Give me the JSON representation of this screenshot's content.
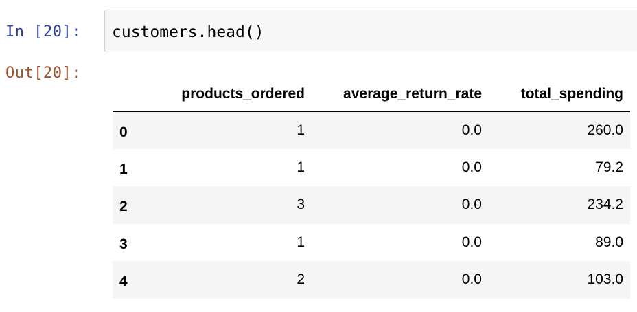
{
  "cell": {
    "in_prompt": "In [20]:",
    "code": "customers.head()",
    "out_prompt": "Out[20]:"
  },
  "dataframe": {
    "columns": [
      "",
      "products_ordered",
      "average_return_rate",
      "total_spending"
    ],
    "rows": [
      {
        "index": "0",
        "products_ordered": "1",
        "average_return_rate": "0.0",
        "total_spending": "260.0"
      },
      {
        "index": "1",
        "products_ordered": "1",
        "average_return_rate": "0.0",
        "total_spending": "79.2"
      },
      {
        "index": "2",
        "products_ordered": "3",
        "average_return_rate": "0.0",
        "total_spending": "234.2"
      },
      {
        "index": "3",
        "products_ordered": "1",
        "average_return_rate": "0.0",
        "total_spending": "89.0"
      },
      {
        "index": "4",
        "products_ordered": "2",
        "average_return_rate": "0.0",
        "total_spending": "103.0"
      }
    ]
  },
  "colors": {
    "in_prompt": "#303f9f",
    "out_prompt": "#a0522d",
    "editor_bg": "#f7f7f7",
    "row_stripe": "#f5f5f5"
  }
}
